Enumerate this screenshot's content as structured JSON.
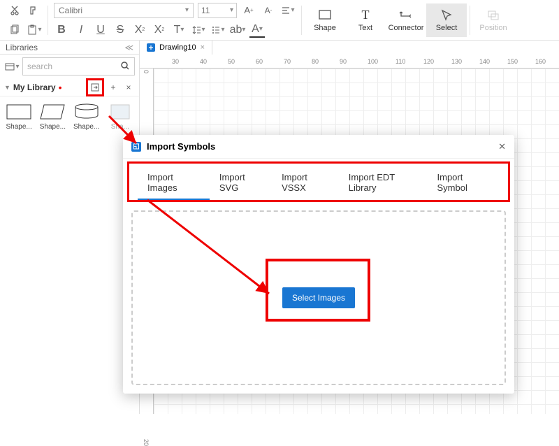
{
  "toolbar": {
    "font": "Calibri",
    "size": "11",
    "shape": "Shape",
    "text": "Text",
    "connector": "Connector",
    "select": "Select",
    "position": "Position"
  },
  "panel": {
    "title": "Libraries"
  },
  "search": {
    "placeholder": "search"
  },
  "library": {
    "name": "My Library"
  },
  "shapes": [
    "Shape...",
    "Shape...",
    "Shape...",
    "Sha..."
  ],
  "tab": {
    "name": "Drawing10"
  },
  "ruler_h": [
    "30",
    "40",
    "50",
    "60",
    "70",
    "80",
    "90",
    "100",
    "110",
    "120",
    "130",
    "140",
    "150",
    "160"
  ],
  "ruler_v": [
    "0",
    "20"
  ],
  "dialog": {
    "title": "Import Symbols",
    "tabs": [
      "Import Images",
      "Import SVG",
      "Import VSSX",
      "Import EDT Library",
      "Import Symbol"
    ],
    "button": "Select Images"
  }
}
